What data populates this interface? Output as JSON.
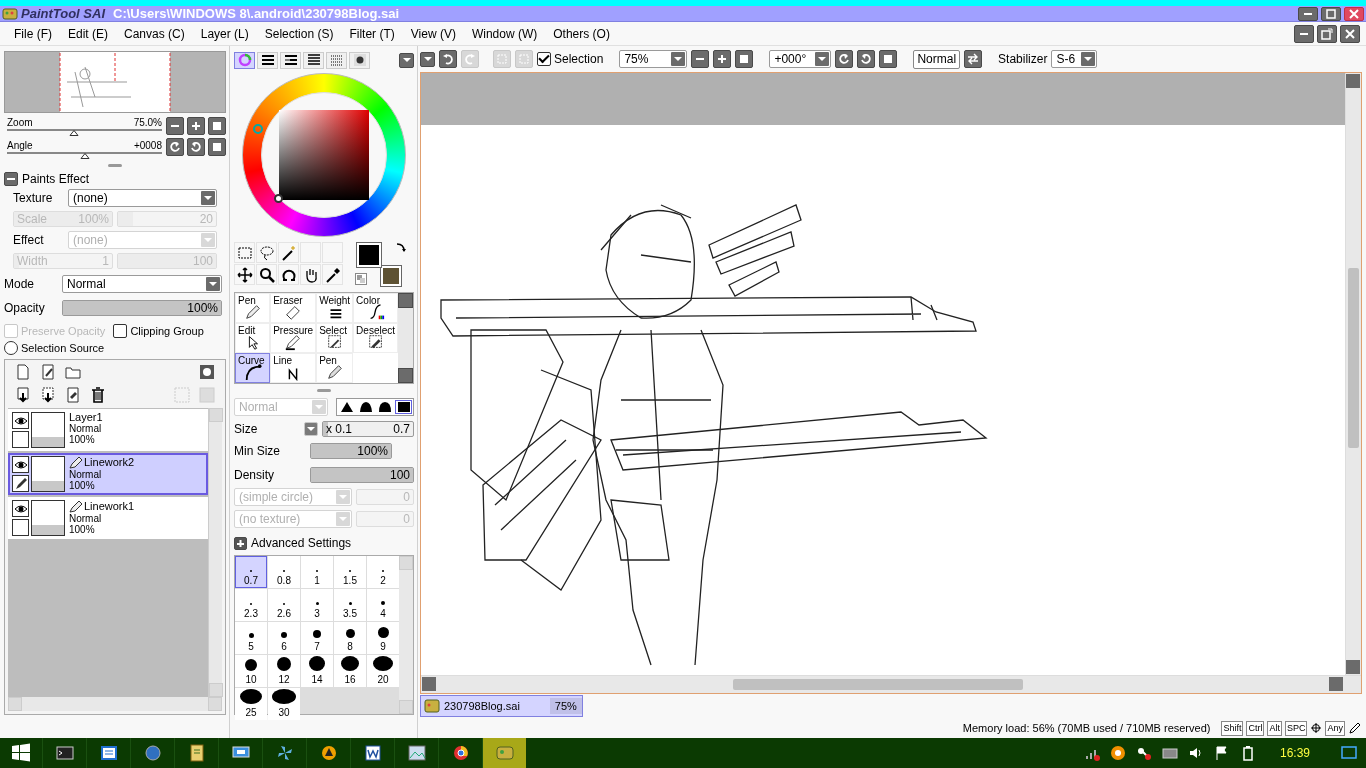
{
  "title_bar": {
    "app_name": "PaintTool SAI",
    "file_path": "C:\\Users\\WINDOWS 8\\.android\\230798Blog.sai"
  },
  "menu": [
    "File (F)",
    "Edit (E)",
    "Canvas (C)",
    "Layer (L)",
    "Selection (S)",
    "Filter (T)",
    "View (V)",
    "Window (W)",
    "Others (O)"
  ],
  "navigator": {
    "zoom": {
      "label": "Zoom",
      "value": "75.0%",
      "level": 0.43
    },
    "angle": {
      "label": "Angle",
      "value": "+0008",
      "level": 0.5
    }
  },
  "paints_effect": {
    "title": "Paints Effect",
    "expanded": true,
    "rows": [
      {
        "kind": "select",
        "label": "Texture",
        "value": "(none)",
        "disabled": false
      },
      {
        "kind": "pair",
        "label": "Scale",
        "value": "100%",
        "level": 1,
        "value_2": {
          "value": "20",
          "level": 0.15
        },
        "disabled": true
      },
      {
        "kind": "select",
        "label": "Effect",
        "value": "(none)",
        "disabled": true
      },
      {
        "kind": "pair",
        "label": "Width",
        "value": "1",
        "level": 0.05,
        "value_2": {
          "value": "100",
          "level": 1
        },
        "disabled": true
      }
    ]
  },
  "mode": {
    "label": "Mode",
    "value": "Normal"
  },
  "opacity": {
    "label": "Opacity",
    "value": "100%",
    "level": 1
  },
  "options": [
    {
      "label": "Preserve Opacity",
      "checked": false,
      "disabled": true
    },
    {
      "label": "Clipping Group",
      "checked": false,
      "disabled": false
    }
  ],
  "selection_source": {
    "label": "Selection Source",
    "selected": false
  },
  "layers": [
    {
      "kind": "normal",
      "name": "Layer1",
      "mode": "Normal",
      "opacity": "100%",
      "selected": false
    },
    {
      "kind": "linework",
      "name": "Linework2",
      "mode": "Normal",
      "opacity": "100%",
      "selected": true
    },
    {
      "kind": "linework",
      "name": "Linework1",
      "mode": "Normal",
      "opacity": "100%",
      "selected": false
    }
  ],
  "color_mode_tabs": [
    {
      "selected": true
    },
    {
      "selected": false
    },
    {
      "selected": false
    },
    {
      "selected": false
    },
    {
      "selected": false
    },
    {
      "selected": false
    }
  ],
  "swatches": [
    {
      "color": "#000000"
    },
    {
      "color": "#5e5233"
    }
  ],
  "brush_tools": [
    {
      "label": "Pen",
      "selected": false
    },
    {
      "label": "Eraser",
      "selected": false
    },
    {
      "label": "Weight",
      "selected": false
    },
    {
      "label": "Color",
      "selected": false
    },
    {
      "label": "Edit",
      "selected": false
    },
    {
      "label": "Pressure",
      "selected": false
    },
    {
      "label": "Select",
      "selected": false
    },
    {
      "label": "Deselect",
      "selected": false
    },
    {
      "label": "Curve",
      "selected": true
    },
    {
      "label": "Line",
      "selected": false
    },
    {
      "label": "Pen",
      "selected": false
    }
  ],
  "brush_settings": {
    "blend_mode": "Normal",
    "shapes": [
      {
        "selected": false
      },
      {
        "selected": false
      },
      {
        "selected": false
      },
      {
        "selected": true
      }
    ],
    "size": {
      "label": "Size",
      "multiplier": "x 0.1",
      "value": "0.7",
      "level": 0.05
    },
    "min_size": {
      "label": "Min Size",
      "value": "100%",
      "level": 1
    },
    "density": {
      "label": "Density",
      "value": "100",
      "level": 1
    },
    "shape_options": [
      {
        "value": "(simple circle)",
        "amount": "0",
        "level": 0
      },
      {
        "value": "(no texture)",
        "amount": "0",
        "level": 0
      }
    ],
    "advanced": {
      "label": "Advanced Settings",
      "expanded": false
    }
  },
  "brush_sizes": [
    {
      "label": "0.7",
      "selected": true
    },
    {
      "label": "0.8",
      "selected": false
    },
    {
      "label": "1",
      "selected": false
    },
    {
      "label": "1.5",
      "selected": false
    },
    {
      "label": "2",
      "selected": false
    },
    {
      "label": "2.3",
      "selected": false
    },
    {
      "label": "2.6",
      "selected": false
    },
    {
      "label": "3",
      "selected": false
    },
    {
      "label": "3.5",
      "selected": false
    },
    {
      "label": "4",
      "selected": false
    },
    {
      "label": "5",
      "selected": false
    },
    {
      "label": "6",
      "selected": false
    },
    {
      "label": "7",
      "selected": false
    },
    {
      "label": "8",
      "selected": false
    },
    {
      "label": "9",
      "selected": false
    },
    {
      "label": "10",
      "selected": false
    },
    {
      "label": "12",
      "selected": false
    },
    {
      "label": "14",
      "selected": false
    },
    {
      "label": "16",
      "selected": false
    },
    {
      "label": "20",
      "selected": false
    },
    {
      "label": "25",
      "selected": false
    },
    {
      "label": "30",
      "selected": false
    }
  ],
  "toolbar": {
    "selection": {
      "label": "Selection",
      "checked": true
    },
    "zoom": "75%",
    "rotation": "+000°",
    "blend": "Normal",
    "stabilizer_label": "Stabilizer",
    "stabilizer": "S-6"
  },
  "file_tabs": [
    {
      "name": "230798Blog.sai",
      "zoom": "75%",
      "selected": true
    }
  ],
  "status_bar": {
    "memory": "Memory load: 56% (70MB used / 710MB reserved)",
    "keys": [
      "Shift",
      "Ctrl",
      "Alt",
      "SPC",
      "Any"
    ]
  },
  "taskbar": {
    "apps": [
      {
        "selected": false
      },
      {
        "selected": false
      },
      {
        "selected": false
      },
      {
        "selected": false
      },
      {
        "selected": false
      },
      {
        "selected": false
      },
      {
        "selected": false
      },
      {
        "selected": false
      },
      {
        "selected": false
      },
      {
        "selected": false
      },
      {
        "selected": true
      }
    ],
    "clock": "16:39"
  }
}
